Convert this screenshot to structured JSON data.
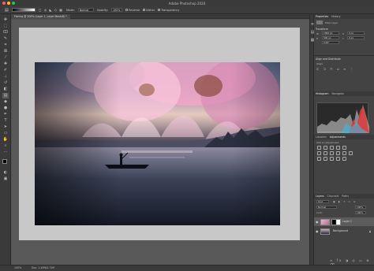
{
  "app": {
    "title": "Adobe Photoshop 2020"
  },
  "options_bar": {
    "mode_label": "Mode:",
    "mode_value": "Normal",
    "opacity_label": "Opacity:",
    "opacity_value": "100%",
    "reverse_label": "Reverse",
    "dither_label": "Dither",
    "transparency_label": "Transparency"
  },
  "document": {
    "tab_label": "Fishing @ 200% (Layer 1, Layer Mask/8) *",
    "canvas_color": "#c8c8c8"
  },
  "statusbar": {
    "zoom": "100%",
    "doc_info": "Doc: 1.40M/4.71M"
  },
  "panels": {
    "properties": {
      "tabs": [
        "Properties",
        "History"
      ],
      "layer_type": "Pixel Layer",
      "transform_heading": "Transform",
      "w_label": "W",
      "w_value": "1000 px",
      "h_label": "H",
      "h_value": "500 px",
      "x_label": "X",
      "x_value": "0 px",
      "y_label": "Y",
      "y_value": "0 px",
      "angle_value": "0.00°",
      "align_heading": "Align and Distribute",
      "align_sub": "Align:"
    },
    "histogram": {
      "tabs": [
        "Histogram",
        "Navigator"
      ]
    },
    "adjustments": {
      "tabs": [
        "Libraries",
        "Adjustments"
      ],
      "add_label": "Add an adjustment"
    },
    "layers": {
      "tabs": [
        "Layers",
        "Channels",
        "Paths"
      ],
      "filter_label": "Kind",
      "blend_value": "Normal",
      "opacity_value": "100%",
      "fill_value": "100%",
      "lock_label": "Lock:",
      "items": [
        {
          "name": "Layer 1"
        },
        {
          "name": "Background"
        }
      ]
    }
  },
  "colors": {
    "accent": "#4a8af4",
    "foreground": "#000000",
    "background_color": "#ffffff"
  }
}
